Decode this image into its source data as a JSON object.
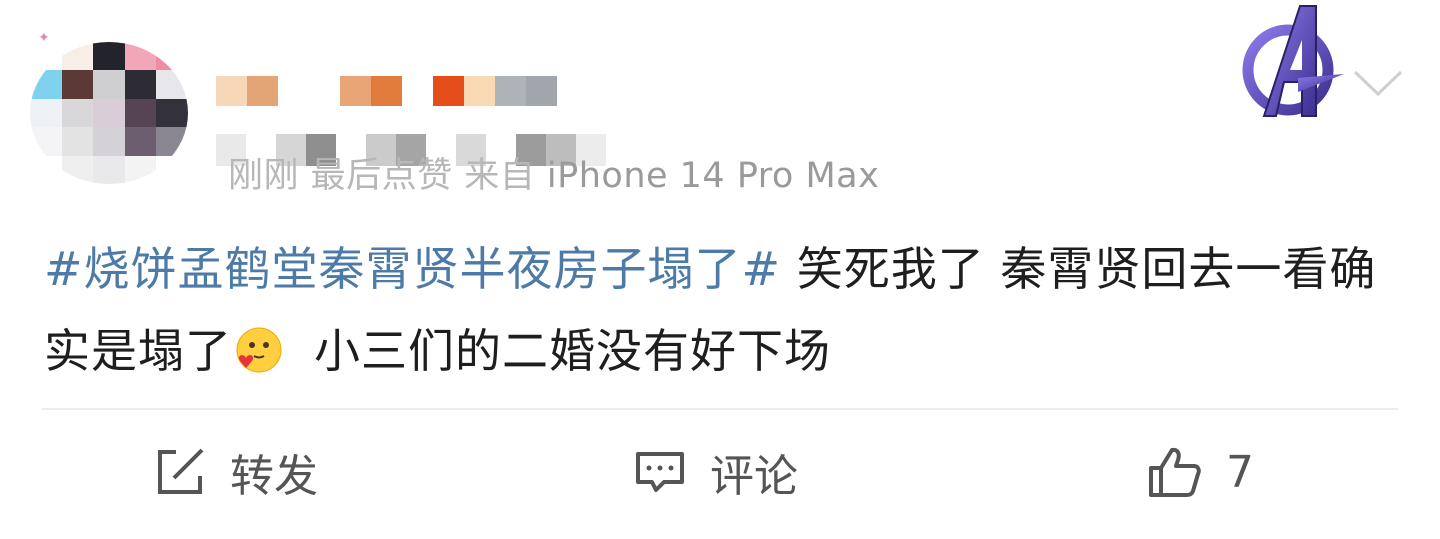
{
  "post": {
    "meta_text": "iPhone 14 Pro Max",
    "meta_blurred": "刚刚  最后点赞  来自 ",
    "body_hashtag": "#烧饼孟鹤堂秦霄贤半夜房子塌了#",
    "body_text_1": " 笑死我了 秦霄贤回去一看确实是塌了",
    "body_text_2": "小三们的二婚没有好下场",
    "emoji": "heart-face-emoji"
  },
  "actions": {
    "repost_label": "转发",
    "comment_label": "评论",
    "like_count": "7"
  },
  "colors": {
    "hashtag": "#4d7aa7",
    "text": "#1e1e1e",
    "meta": "#9a9a9a",
    "action": "#555555",
    "divider": "#ececec"
  },
  "icons": {
    "repost": "repost-icon",
    "comment": "comment-icon",
    "like": "thumbs-up-icon",
    "more": "chevron-down-icon",
    "badge": "avengers-logo-badge"
  }
}
